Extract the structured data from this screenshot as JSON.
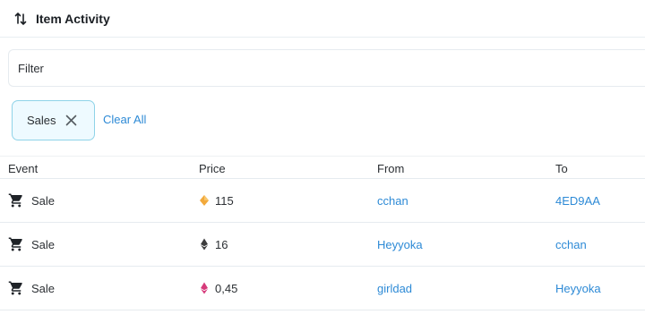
{
  "header": {
    "title": "Item Activity",
    "icon": "sort-arrows-icon"
  },
  "filter": {
    "label": "Filter"
  },
  "chips": {
    "active": "Sales",
    "clear_all": "Clear All"
  },
  "table": {
    "columns": [
      "Event",
      "Price",
      "From",
      "To"
    ],
    "rows": [
      {
        "event": "Sale",
        "price": "115",
        "currency_icon": "diamond-token-icon",
        "currency_color": "#f2a93b",
        "from": "cchan",
        "to": "4ED9AA"
      },
      {
        "event": "Sale",
        "price": "16",
        "currency_icon": "eth-icon",
        "currency_color": "#3c3c3d",
        "from": "Heyyoka",
        "to": "cchan"
      },
      {
        "event": "Sale",
        "price": "0,45",
        "currency_icon": "weth-icon",
        "currency_color": "#d63a7a",
        "from": "girldad",
        "to": "Heyyoka"
      }
    ]
  },
  "colors": {
    "link": "#2d8ad6",
    "chip_border": "#8fd3e8",
    "chip_bg": "#eefaff"
  }
}
